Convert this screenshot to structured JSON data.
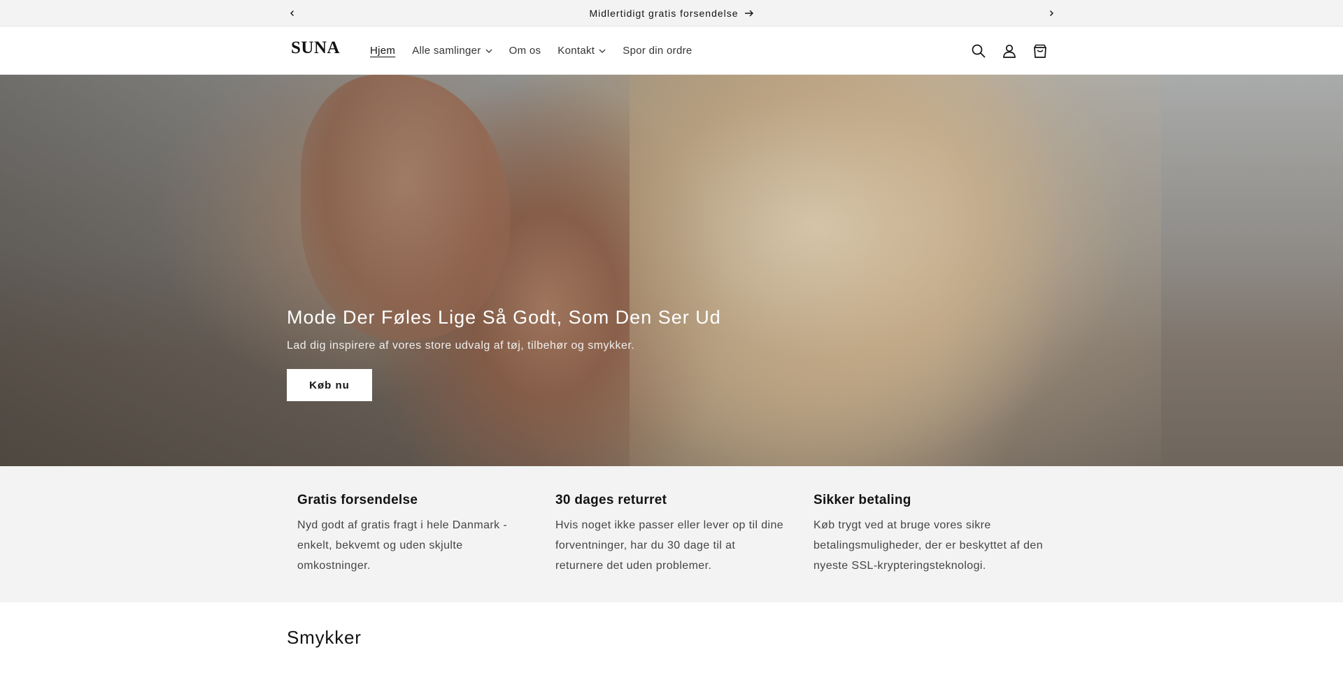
{
  "announcement": {
    "text": "Midlertidigt gratis forsendelse",
    "prev_icon": "chevron-left-icon",
    "next_icon": "chevron-right-icon"
  },
  "header": {
    "logo": "SUNA",
    "nav": [
      {
        "label": "Hjem",
        "active": true
      },
      {
        "label": "Alle samlinger",
        "has_dropdown": true
      },
      {
        "label": "Om os"
      },
      {
        "label": "Kontakt",
        "has_dropdown": true
      },
      {
        "label": "Spor din ordre"
      }
    ],
    "icons": [
      "search-icon",
      "account-icon",
      "cart-icon"
    ]
  },
  "hero": {
    "title": "Mode Der Føles Lige Så Godt, Som Den Ser Ud",
    "subtitle": "Lad dig inspirere af vores store udvalg af tøj, tilbehør og smykker.",
    "button": "Køb nu"
  },
  "features": [
    {
      "title": "Gratis forsendelse",
      "text": "Nyd godt af gratis fragt i hele Danmark - enkelt, bekvemt og uden skjulte omkostninger."
    },
    {
      "title": "30 dages returret",
      "text": "Hvis noget ikke passer eller lever op til dine forventninger, har du 30 dage til at returnere det uden problemer."
    },
    {
      "title": "Sikker betaling",
      "text": "Køb trygt ved at bruge vores sikre betalingsmuligheder, der er beskyttet af den nyeste SSL-krypteringsteknologi."
    }
  ],
  "section": {
    "title": "Smykker"
  },
  "colors": {
    "announcement_bg": "#f3f3f3",
    "features_bg": "#f3f3f3",
    "text": "#121212",
    "button_bg": "#ffffff"
  }
}
